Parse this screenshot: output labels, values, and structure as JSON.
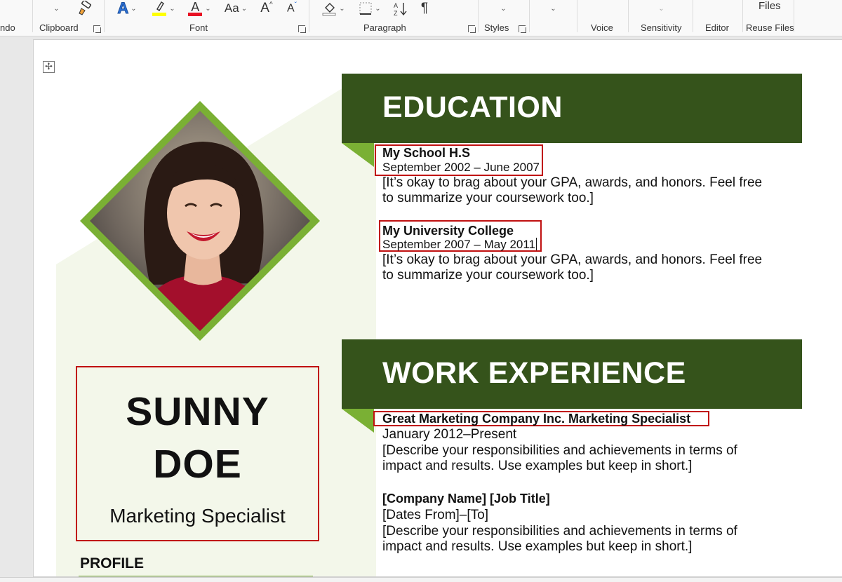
{
  "ribbon": {
    "groups": {
      "undo": "ndo",
      "clipboard": "Clipboard",
      "font": "Font",
      "paragraph": "Paragraph",
      "styles": "Styles",
      "voice": "Voice",
      "sensitivity": "Sensitivity",
      "editor": "Editor",
      "reuse_files": "Reuse Files"
    },
    "files_label": "Files",
    "change_case_label": "Aa",
    "pilcrow": "¶"
  },
  "colors": {
    "dark_green": "#35531b",
    "light_green": "#7ab034",
    "pale_green": "#f3f7ea",
    "highlight_yellow": "#ffff00",
    "font_red": "#e81123",
    "annotation_red": "#c01010"
  },
  "resume": {
    "name_first": "SUNNY",
    "name_last": "DOE",
    "title": "Marketing Specialist",
    "profile_heading": "PROFILE",
    "education": {
      "heading": "EDUCATION",
      "entries": [
        {
          "school": "My School H.S",
          "dates": "September 2002 – June 2007",
          "desc_line1": "[It’s okay to brag about your GPA, awards, and honors. Feel free",
          "desc_line2": "to summarize your coursework too.]"
        },
        {
          "school": "My University College",
          "dates": "September 2007 – May 2011",
          "desc_line1": "[It’s okay to brag about your GPA, awards, and honors. Feel free",
          "desc_line2": "to summarize your coursework too.]"
        }
      ]
    },
    "work": {
      "heading": "WORK EXPERIENCE",
      "entries": [
        {
          "title": "Great Marketing Company Inc.  Marketing Specialist",
          "dates": "January 2012–Present",
          "desc_line1": "[Describe your responsibilities and achievements in terms of",
          "desc_line2": "impact and results. Use examples but keep in short.]"
        },
        {
          "title": "[Company Name]  [Job Title]",
          "dates": "[Dates From]–[To]",
          "desc_line1": "[Describe your responsibilities and achievements in terms of",
          "desc_line2": "impact and results. Use examples but keep in short.]"
        }
      ]
    }
  }
}
